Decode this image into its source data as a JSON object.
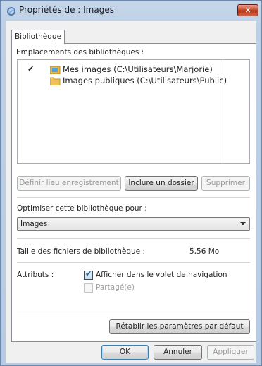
{
  "window": {
    "title": "Propriétés de : Images",
    "close_label": "✕"
  },
  "tabs": [
    {
      "label": "Bibliothèque"
    }
  ],
  "locations": {
    "heading": "Emplacements des bibliothèques :",
    "items": [
      {
        "check": "✔",
        "label": "Mes images (C:\\Utilisateurs\\Marjorie)"
      },
      {
        "check": "",
        "label": "Images publiques (C:\\Utilisateurs\\Public)"
      }
    ],
    "buttons": {
      "set_save": "Définir lieu enregistrement",
      "include": "Inclure un dossier",
      "remove": "Supprimer"
    }
  },
  "optimize": {
    "label": "Optimiser cette bibliothèque pour :",
    "value": "Images"
  },
  "size": {
    "label": "Taille des fichiers de bibliothèque :",
    "value": "5,56 Mo"
  },
  "attributes": {
    "label": "Attributs :",
    "show_nav": "Afficher dans le volet de navigation",
    "shared": "Partagé(e)"
  },
  "restore_label": "Rétablir les paramètres par défaut",
  "footer": {
    "ok": "OK",
    "cancel": "Annuler",
    "apply": "Appliquer"
  },
  "colors": {
    "title_bar": "#c7d7ea",
    "folder": "#e8b84a",
    "close": "#c9462a"
  }
}
